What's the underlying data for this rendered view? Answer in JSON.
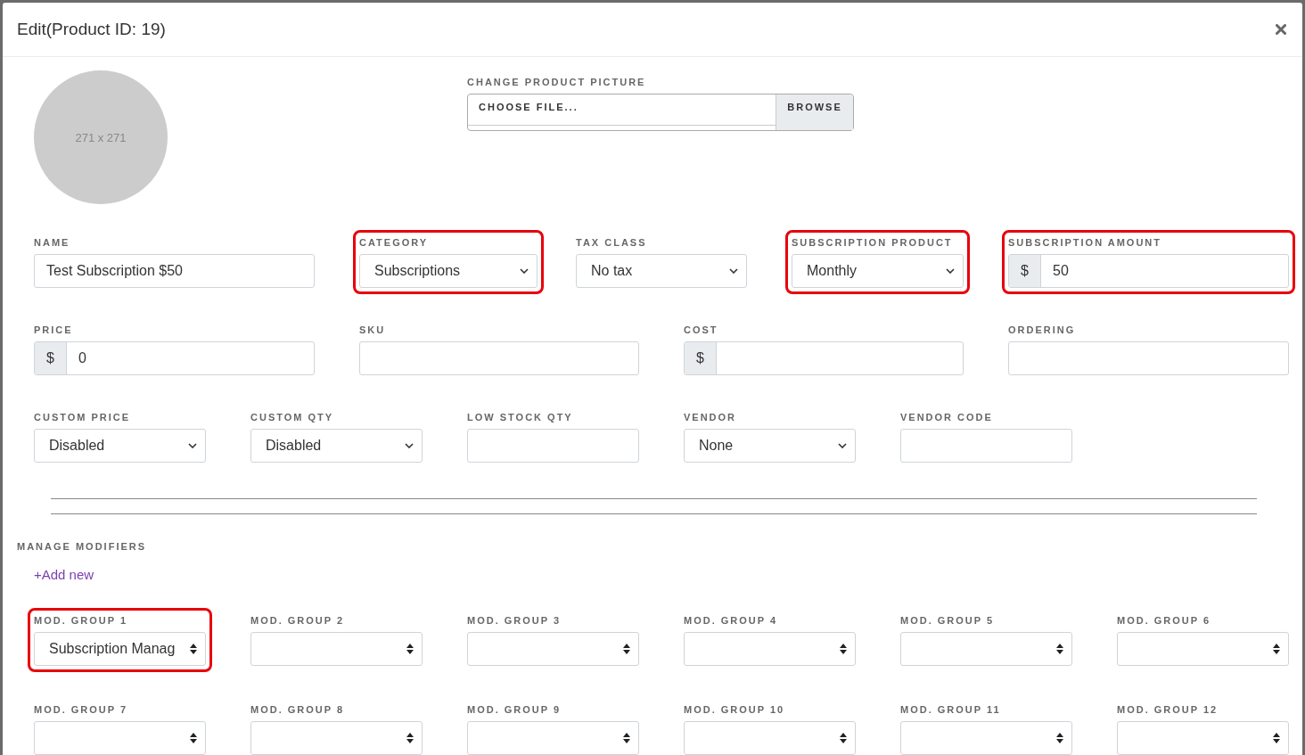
{
  "dialog": {
    "title": "Edit(Product ID: 19)"
  },
  "picture": {
    "placeholder": "271 x 271"
  },
  "file_picker": {
    "label": "CHANGE PRODUCT PICTURE",
    "placeholder": "CHOOSE FILE...",
    "button": "BROWSE"
  },
  "rows": [
    [
      {
        "label": "NAME",
        "kind": "text",
        "value": "Test Subscription $50",
        "highlighted": false
      },
      {
        "label": "CATEGORY",
        "kind": "select",
        "value": "Subscriptions",
        "highlighted": true
      },
      {
        "label": "TAX CLASS",
        "kind": "select",
        "value": "No tax",
        "highlighted": false
      },
      {
        "label": "SUBSCRIPTION PRODUCT",
        "kind": "select",
        "value": "Monthly",
        "highlighted": true
      },
      {
        "label": "SUBSCRIPTION AMOUNT",
        "kind": "money",
        "prefix": "$",
        "value": "50",
        "highlighted": true
      }
    ],
    [
      {
        "label": "PRICE",
        "kind": "money",
        "prefix": "$",
        "value": "0",
        "highlighted": false
      },
      {
        "label": "SKU",
        "kind": "text",
        "highlighted": false
      },
      {
        "label": "COST",
        "kind": "money",
        "prefix": "$",
        "highlighted": false
      },
      {
        "label": "ORDERING",
        "kind": "text",
        "highlighted": false
      }
    ],
    [
      {
        "label": "CUSTOM PRICE",
        "kind": "select",
        "value": "Disabled",
        "highlighted": false
      },
      {
        "label": "CUSTOM QTY",
        "kind": "select",
        "value": "Disabled",
        "highlighted": false
      },
      {
        "label": "LOW STOCK QTY",
        "kind": "text",
        "highlighted": false
      },
      {
        "label": "VENDOR",
        "kind": "select",
        "value": "None",
        "highlighted": false
      },
      {
        "label": "VENDOR CODE",
        "kind": "text",
        "highlighted": false
      }
    ]
  ],
  "modifiers": {
    "title": "MANAGE MODIFIERS",
    "add_link": "+Add new",
    "groups": [
      {
        "label": "MOD. GROUP 1",
        "value": "Subscription Manag",
        "highlighted": true
      },
      {
        "label": "MOD. GROUP 2",
        "highlighted": false
      },
      {
        "label": "MOD. GROUP 3",
        "highlighted": false
      },
      {
        "label": "MOD. GROUP 4",
        "highlighted": false
      },
      {
        "label": "MOD. GROUP 5",
        "highlighted": false
      },
      {
        "label": "MOD. GROUP 6",
        "highlighted": false
      },
      {
        "label": "MOD. GROUP 7",
        "highlighted": false
      },
      {
        "label": "MOD. GROUP 8",
        "highlighted": false
      },
      {
        "label": "MOD. GROUP 9",
        "highlighted": false
      },
      {
        "label": "MOD. GROUP 10",
        "highlighted": false
      },
      {
        "label": "MOD. GROUP 11",
        "highlighted": false
      },
      {
        "label": "MOD. GROUP 12",
        "highlighted": false
      }
    ]
  }
}
